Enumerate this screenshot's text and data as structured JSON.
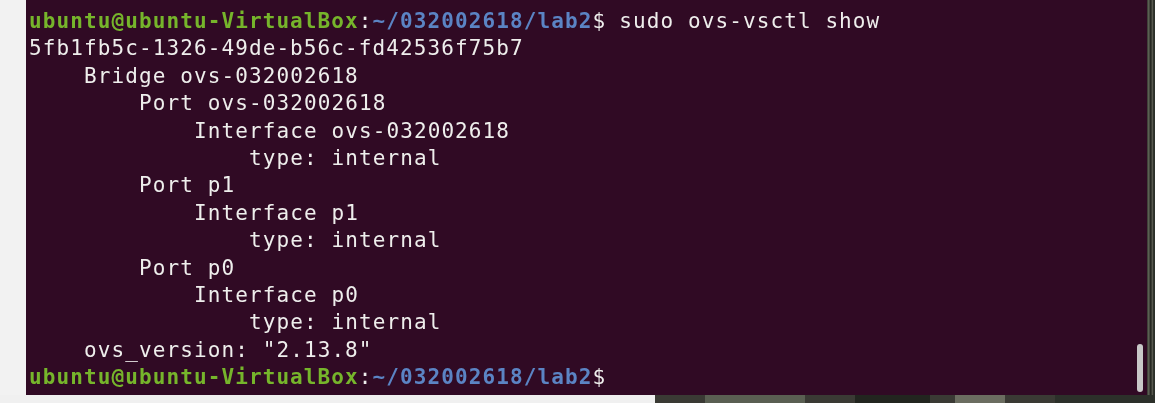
{
  "terminal": {
    "lines": [
      {
        "kind": "prompt",
        "user_host": "ubuntu@ubuntu-VirtualBox",
        "separator": ":",
        "path": "~/032002618/lab2",
        "symbol": "$",
        "command": "sudo ovs-vsctl show"
      },
      {
        "kind": "output",
        "text": "5fb1fb5c-1326-49de-b56c-fd42536f75b7",
        "children": [
          {
            "text": "Bridge ovs-032002618",
            "children": [
              {
                "text": "Port ovs-032002618",
                "children": [
                  {
                    "text": "Interface ovs-032002618",
                    "children": [
                      {
                        "text": "type: internal"
                      }
                    ]
                  }
                ]
              },
              {
                "text": "Port p1",
                "children": [
                  {
                    "text": "Interface p1",
                    "children": [
                      {
                        "text": "type: internal"
                      }
                    ]
                  }
                ]
              },
              {
                "text": "Port p0",
                "children": [
                  {
                    "text": "Interface p0",
                    "children": [
                      {
                        "text": "type: internal"
                      }
                    ]
                  }
                ]
              }
            ]
          },
          {
            "text": "ovs_version: \"2.13.8\""
          }
        ]
      },
      {
        "kind": "prompt",
        "user_host": "ubuntu@ubuntu-VirtualBox",
        "separator": ":",
        "path": "~/032002618/lab2",
        "symbol": "$"
      }
    ]
  }
}
